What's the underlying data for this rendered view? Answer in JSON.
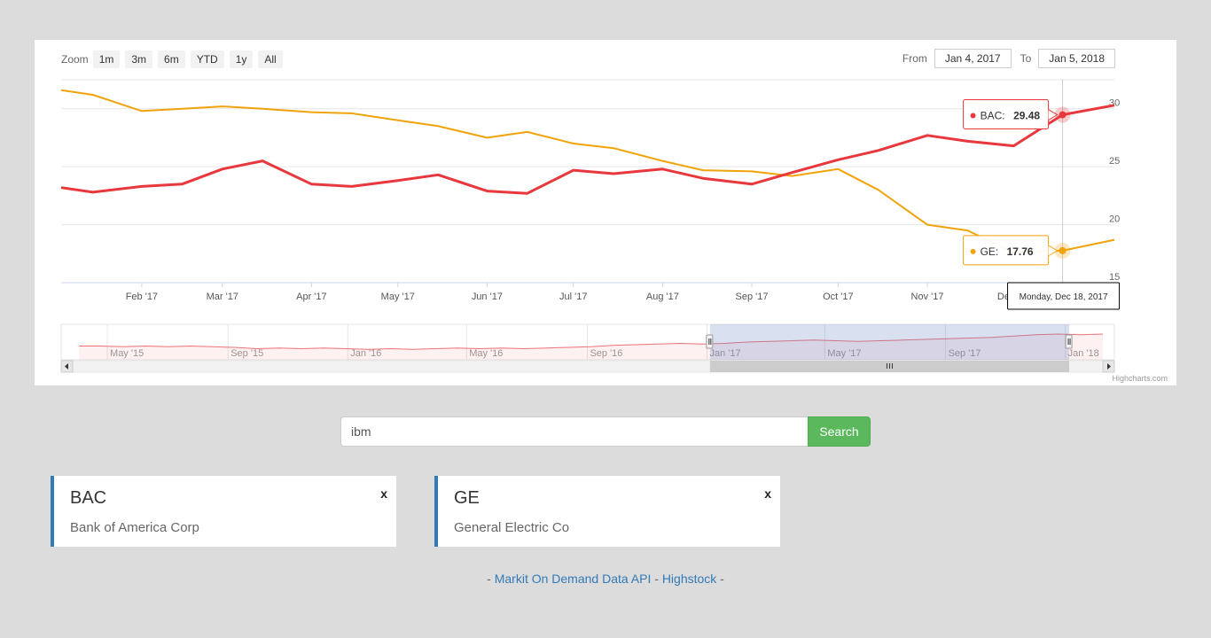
{
  "range_selector": {
    "zoom_label": "Zoom",
    "buttons": [
      "1m",
      "3m",
      "6m",
      "YTD",
      "1y",
      "All"
    ],
    "from_label": "From",
    "from_value": "Jan 4, 2017",
    "to_label": "To",
    "to_value": "Jan 5, 2018"
  },
  "chart_data": {
    "type": "line",
    "x": [
      "2017-01-04",
      "2017-01-15",
      "2017-02-01",
      "2017-02-15",
      "2017-03-01",
      "2017-03-15",
      "2017-04-01",
      "2017-04-15",
      "2017-05-01",
      "2017-05-15",
      "2017-06-01",
      "2017-06-15",
      "2017-07-01",
      "2017-07-15",
      "2017-08-01",
      "2017-08-15",
      "2017-09-01",
      "2017-09-15",
      "2017-10-01",
      "2017-10-15",
      "2017-11-01",
      "2017-11-15",
      "2017-12-01",
      "2017-12-18",
      "2018-01-05"
    ],
    "series": [
      {
        "name": "BAC",
        "color": "#e8383d",
        "values": [
          23.2,
          22.8,
          23.3,
          23.5,
          24.8,
          25.5,
          23.5,
          23.3,
          23.8,
          24.3,
          22.9,
          22.7,
          24.7,
          24.4,
          24.8,
          24.0,
          23.5,
          24.5,
          25.6,
          26.4,
          27.7,
          27.2,
          26.8,
          29.48,
          30.3
        ]
      },
      {
        "name": "GE",
        "color": "#f0a30a",
        "values": [
          31.6,
          31.2,
          29.8,
          30.0,
          30.2,
          30.0,
          29.7,
          29.6,
          29.0,
          28.5,
          27.5,
          28.0,
          27.0,
          26.6,
          25.5,
          24.7,
          24.6,
          24.2,
          24.8,
          23.0,
          20.0,
          19.5,
          17.6,
          17.76,
          18.7
        ]
      }
    ],
    "y_ticks": [
      "15",
      "20",
      "25",
      "30"
    ],
    "ylim": [
      15,
      32.5
    ],
    "x_tick_labels": [
      "Feb '17",
      "Mar '17",
      "Apr '17",
      "May '17",
      "Jun '17",
      "Jul '17",
      "Aug '17",
      "Sep '17",
      "Oct '17",
      "Nov '17",
      "Dec '17"
    ],
    "grid": true,
    "tooltip": {
      "date": "Monday, Dec 18, 2017",
      "points": [
        {
          "series": "BAC",
          "value": "29.48"
        },
        {
          "series": "GE",
          "value": "17.76"
        }
      ]
    },
    "navigator": {
      "labels": [
        "May '15",
        "Sep '15",
        "Jan '16",
        "May '16",
        "Sep '16",
        "Jan '17",
        "May '17",
        "Sep '17",
        "Jan '18"
      ]
    }
  },
  "credits": "Highcharts.com",
  "search": {
    "value": "ibm",
    "button_label": "Search"
  },
  "stocks": [
    {
      "symbol": "BAC",
      "name": "Bank of America Corp",
      "close": "x"
    },
    {
      "symbol": "GE",
      "name": "General Electric Co",
      "close": "x"
    }
  ],
  "footer": {
    "prefix": "- ",
    "link1": "Markit On Demand Data API",
    "sep": " - ",
    "link2": "Highstock",
    "suffix": " -"
  }
}
